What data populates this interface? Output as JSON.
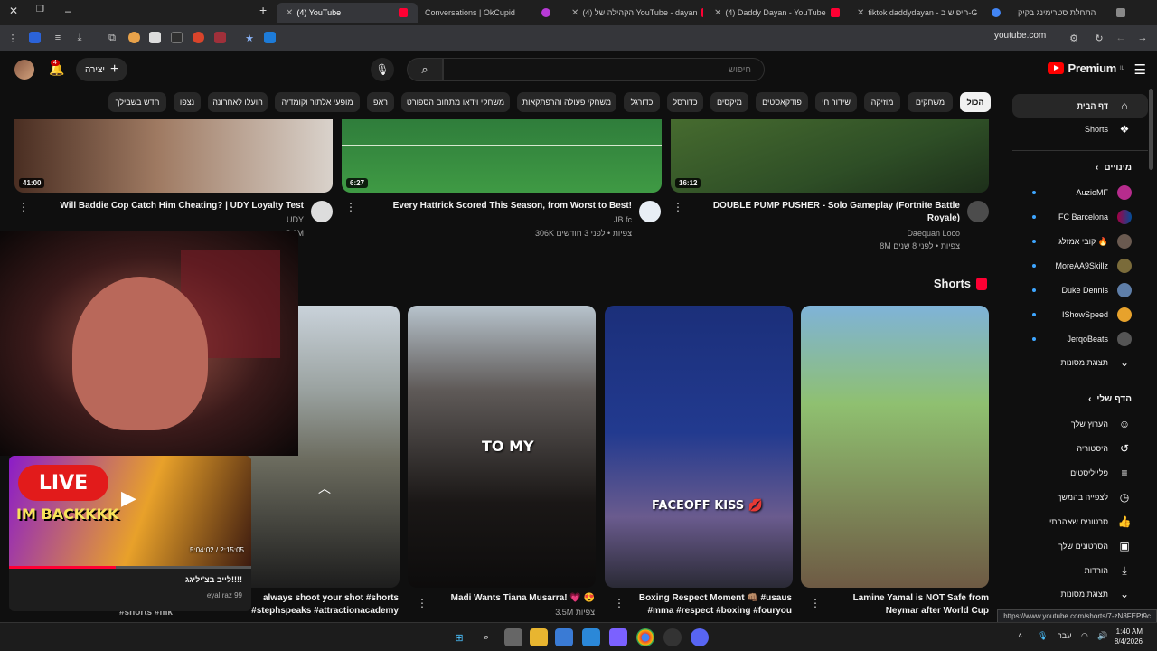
{
  "tabs": [
    {
      "title": "התחלת סטרימינג בקיק",
      "active": false
    },
    {
      "title": "tiktok daddydayan - חיפוש ב-G",
      "active": false
    },
    {
      "title": "(4) Daddy Dayan - YouTube",
      "active": false
    },
    {
      "title": "(4) הקהילה של YouTube - dayan",
      "active": false
    },
    {
      "title": "Conversations | OkCupid",
      "active": false
    },
    {
      "title": "(4) YouTube",
      "active": true
    }
  ],
  "browser": {
    "url": "youtube.com"
  },
  "header": {
    "logo_word": "Premium",
    "logo_sup": "IL",
    "search_placeholder": "חיפוש",
    "create_label": "יצירה",
    "notification_count": "4"
  },
  "chips": [
    "הכול",
    "משחקים",
    "מוזיקה",
    "שידור חי",
    "פודקאסטים",
    "מיקסים",
    "כדורסל",
    "כדורגל",
    "משחקי פעולה והרפתקאות",
    "משחקי וידאו מתחום הספורט",
    "ראפ",
    "מופעי אלתור וקומדיה",
    "הועלו לאחרונה",
    "נצפו",
    "חדש בשבילך"
  ],
  "sidebar": {
    "home": "דף הבית",
    "shorts": "Shorts",
    "subscriptions_head": "מינויים",
    "subscriptions": [
      "AuzioMF",
      "FC Barcelona",
      "קובי אמזלג 🔥",
      "MoreAA9Skillz",
      "Duke Dennis",
      "IShowSpeed",
      "JerqoBeats"
    ],
    "show_more": "תצוגת מסונות",
    "you_head": "הדף שלי",
    "you_items": [
      "הערוץ שלך",
      "היסטוריה",
      "פלייליסטים",
      "לצפייה בהמשך",
      "סרטונים שאהבתי",
      "הסרטונים שלך",
      "הורדות"
    ],
    "you_more": "תצוגת מסונות"
  },
  "videos": [
    {
      "title": "DOUBLE PUMP PUSHER - Solo Gameplay (Fortnite Battle Royale)",
      "title_line1": "DOUBLE PUMP PUSHER - Solo Gameplay (Fortnite Battle",
      "title_line2": "Royale)",
      "channel": "Daequan Loco",
      "meta": "8M צפיות • לפני 8 שנים",
      "duration": "16:12"
    },
    {
      "title": "Every Hattrick Scored This Season, from Worst to Best!",
      "channel": "JB fc",
      "meta": "306K צפיות • לפני 3 חודשים",
      "duration": "6:27"
    },
    {
      "title": "Will Baddie Cop Catch Him Cheating? | UDY Loyalty Test",
      "channel": "UDY",
      "meta": "5.6M",
      "duration": "41:00"
    }
  ],
  "shorts": {
    "heading": "Shorts",
    "items": [
      {
        "line1": "Lamine Yamal is NOT Safe from",
        "line2": "Neymar after World Cup",
        "overlay": ""
      },
      {
        "line1": "Boxing Respect Moment 👊🏽 #usaus",
        "line2": "#mma #respect #boxing #fouryou",
        "overlay": "FACEOFF KISS 💋"
      },
      {
        "line1": "Madi Wants Tiana Musarra! 💗 😍",
        "line2": "",
        "views": "3.5M צפיות",
        "overlay": "TO MY"
      },
      {
        "line1": "always shoot your shot #shorts",
        "line2": "#stephspeaks #attractionacademy",
        "overlay": ""
      },
      {
        "line1": "#shorts #mk",
        "line2": "",
        "overlay": ""
      }
    ]
  },
  "miniplayer": {
    "banner_top": "LIVE",
    "banner_bottom": "IM BACKKKK",
    "time": "5:04:02 / 2:15:05",
    "progress": 0.44,
    "title": "לייב בצ'יליגג!!!!",
    "channel": "eyal raz 99"
  },
  "statusbar": "https://www.youtube.com/shorts/7-zN8FEPt9c",
  "taskbar": {
    "lang": "עבר",
    "time": "1:40 AM",
    "date": "8/4/2026"
  }
}
